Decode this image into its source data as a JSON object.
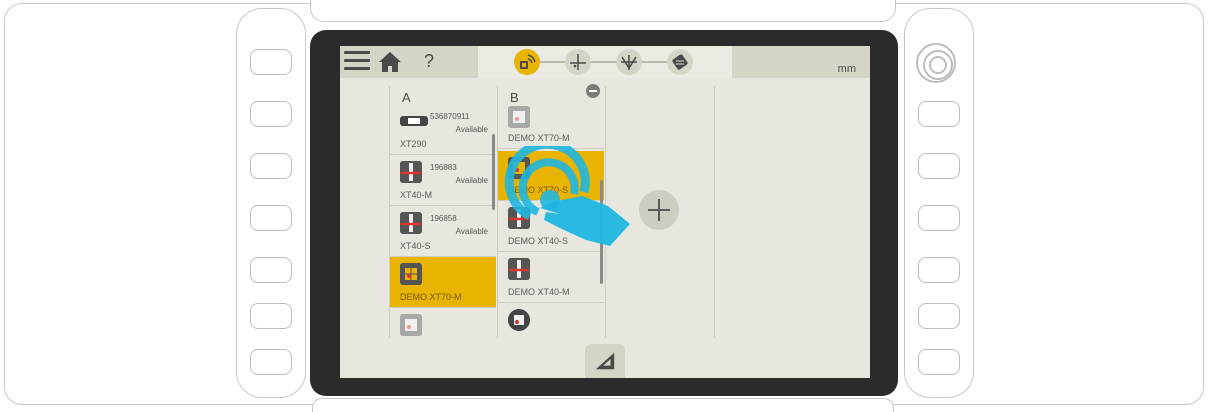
{
  "topbar": {
    "menu_icon": "hamburger-menu-icon",
    "home_icon": "home-icon",
    "help_label": "?",
    "unit_label": "mm"
  },
  "steps": [
    {
      "icon": "sensor-connect-icon",
      "active": true
    },
    {
      "icon": "crosshair-icon",
      "active": false
    },
    {
      "icon": "level-check-icon",
      "active": false
    },
    {
      "icon": "measure-icon",
      "active": false
    }
  ],
  "column_a": {
    "header": "A",
    "items": [
      {
        "serial": "536870911",
        "status": "Available",
        "name": "XT290",
        "icon": "xt290-device-icon",
        "selected": false
      },
      {
        "serial": "196883",
        "status": "Available",
        "name": "XT40-M",
        "icon": "xt40-device-icon",
        "selected": false
      },
      {
        "serial": "196858",
        "status": "Available",
        "name": "XT40-S",
        "icon": "xt40-device-icon",
        "selected": false
      },
      {
        "serial": "",
        "status": "",
        "name": "DEMO XT70-M",
        "icon": "xt70-device-icon",
        "selected": true
      },
      {
        "serial": "",
        "status": "",
        "name": "",
        "icon": "xt70-device-icon",
        "selected": false
      }
    ]
  },
  "column_b": {
    "header": "B",
    "remove_icon": "minus-circle-icon",
    "items": [
      {
        "name": "DEMO XT70-M",
        "icon": "xt70-device-icon",
        "selected": false
      },
      {
        "name": "DEMO XT70-S",
        "icon": "xt70-device-icon",
        "selected": true
      },
      {
        "name": "DEMO XT40-S",
        "icon": "xt40-device-icon",
        "selected": false
      },
      {
        "name": "DEMO XT40-M",
        "icon": "xt40-device-icon",
        "selected": false
      },
      {
        "name": "",
        "icon": "round-device-icon",
        "selected": false
      }
    ]
  },
  "add_button_icon": "plus-icon",
  "ruler_button_icon": "set-square-ruler-icon",
  "gesture_icon": "tap-hand-icon",
  "colors": {
    "accent": "#e8b400",
    "screen_bg": "#e8e7df",
    "bar_bg": "#d6d4c6",
    "gesture": "#1fb6e0",
    "laser_red": "#d9342b"
  }
}
